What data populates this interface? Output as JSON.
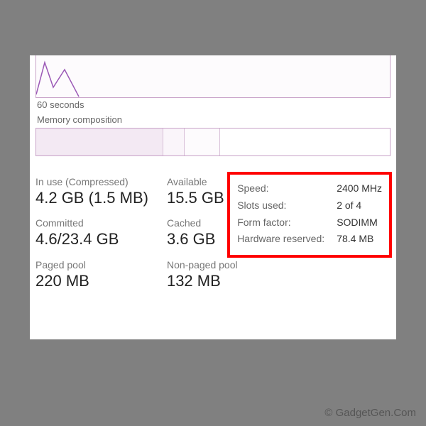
{
  "graph": {
    "axis_label": "60 seconds"
  },
  "composition": {
    "label": "Memory composition"
  },
  "stats": {
    "in_use": {
      "label": "In use (Compressed)",
      "value": "4.2 GB (1.5 MB)"
    },
    "available": {
      "label": "Available",
      "value": "15.5 GB"
    },
    "committed": {
      "label": "Committed",
      "value": "4.6/23.4 GB"
    },
    "cached": {
      "label": "Cached",
      "value": "3.6 GB"
    },
    "paged": {
      "label": "Paged pool",
      "value": "220 MB"
    },
    "nonpaged": {
      "label": "Non-paged pool",
      "value": "132 MB"
    }
  },
  "specs": {
    "speed": {
      "label": "Speed:",
      "value": "2400 MHz"
    },
    "slots": {
      "label": "Slots used:",
      "value": "2 of 4"
    },
    "form": {
      "label": "Form factor:",
      "value": "SODIMM"
    },
    "reserved": {
      "label": "Hardware reserved:",
      "value": "78.4 MB"
    }
  },
  "watermark": "© GadgetGen.Com"
}
